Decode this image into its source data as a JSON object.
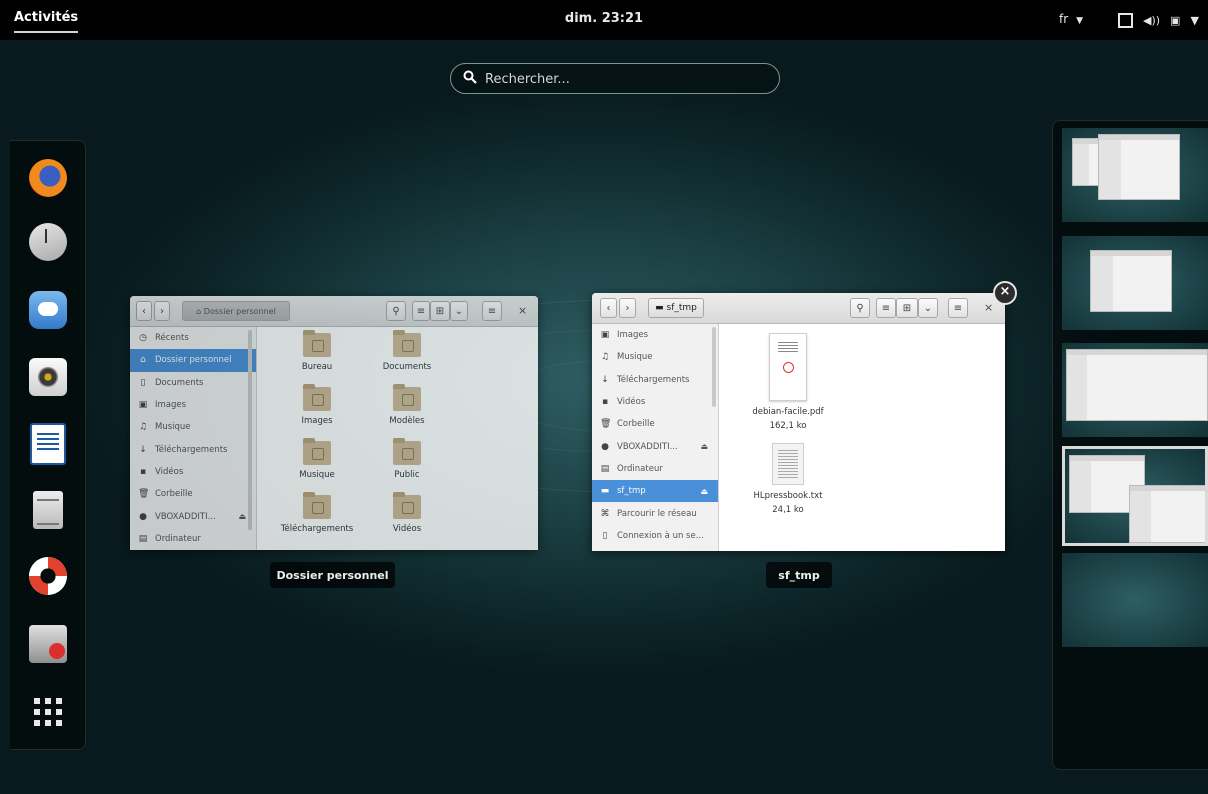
{
  "topbar": {
    "activities": "Activités",
    "clock": "dim. 23:21",
    "language": "fr",
    "status_icons": [
      "window-icon",
      "volume-icon",
      "battery-icon",
      "dropdown-icon"
    ]
  },
  "search": {
    "placeholder": "Rechercher..."
  },
  "dash": {
    "items": [
      "firefox-icon",
      "clocks-icon",
      "empathy-icon",
      "rhythmbox-icon",
      "writer-icon",
      "files-cabinet-icon",
      "help-icon",
      "software-installer-icon",
      "show-apps-icon"
    ]
  },
  "window1": {
    "path": "Dossier personnel",
    "sidebar": [
      {
        "icon": "recent-icon",
        "glyph": "◷",
        "label": "Récents"
      },
      {
        "icon": "home-icon",
        "glyph": "⌂",
        "label": "Dossier personnel",
        "selected": true
      },
      {
        "icon": "document-icon",
        "glyph": "▯",
        "label": "Documents"
      },
      {
        "icon": "image-icon",
        "glyph": "▣",
        "label": "Images"
      },
      {
        "icon": "music-icon",
        "glyph": "♫",
        "label": "Musique"
      },
      {
        "icon": "download-icon",
        "glyph": "↓",
        "label": "Téléchargements"
      },
      {
        "icon": "video-icon",
        "glyph": "▪",
        "label": "Vidéos"
      },
      {
        "icon": "trash-icon",
        "glyph": "🗑",
        "label": "Corbeille"
      },
      {
        "icon": "disc-icon",
        "glyph": "●",
        "label": "VBOXADDITI...",
        "eject": "⏏"
      },
      {
        "icon": "computer-icon",
        "glyph": "▤",
        "label": "Ordinateur"
      }
    ],
    "folders": [
      "Bureau",
      "Documents",
      "Images",
      "Modèles",
      "Musique",
      "Public",
      "Téléchargements",
      "Vidéos"
    ],
    "caption": "Dossier personnel"
  },
  "window2": {
    "path": "sf_tmp",
    "sidebar": [
      {
        "icon": "image-icon",
        "glyph": "▣",
        "label": "Images"
      },
      {
        "icon": "music-icon",
        "glyph": "♫",
        "label": "Musique"
      },
      {
        "icon": "download-icon",
        "glyph": "↓",
        "label": "Téléchargements"
      },
      {
        "icon": "video-icon",
        "glyph": "▪",
        "label": "Vidéos"
      },
      {
        "icon": "trash-icon",
        "glyph": "🗑",
        "label": "Corbeille"
      },
      {
        "icon": "disc-icon",
        "glyph": "●",
        "label": "VBOXADDITI...",
        "eject": "⏏"
      },
      {
        "icon": "computer-icon",
        "glyph": "▤",
        "label": "Ordinateur"
      },
      {
        "icon": "drive-icon",
        "glyph": "▬",
        "label": "sf_tmp",
        "selected": true,
        "eject": "⏏"
      },
      {
        "icon": "network-icon",
        "glyph": "⌘",
        "label": "Parcourir le réseau"
      },
      {
        "icon": "server-icon",
        "glyph": "▯",
        "label": "Connexion à un se..."
      }
    ],
    "files": [
      {
        "name": "debian-facile.pdf",
        "size": "162,1 ko",
        "type": "pdf"
      },
      {
        "name": "HLpressbook.txt",
        "size": "24,1 ko",
        "type": "txt"
      }
    ],
    "caption": "sf_tmp",
    "close_glyph": "×"
  }
}
